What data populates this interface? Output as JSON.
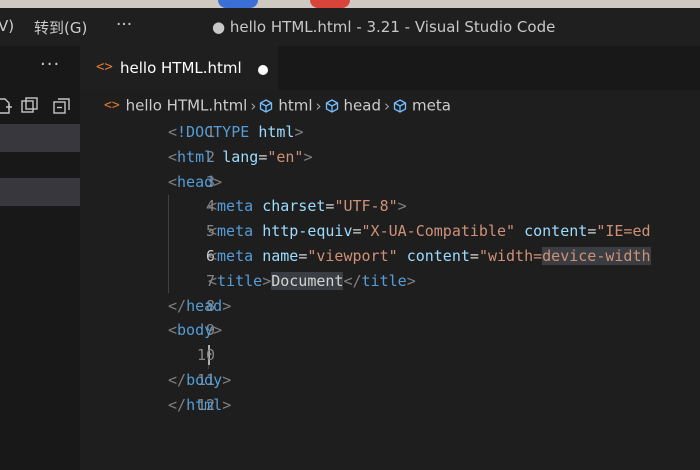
{
  "window": {
    "menu_partial": "V)",
    "menu_goto": "转到(G)",
    "menu_more": "···",
    "title": "● hello HTML.html - 3.21 - Visual Studio Code"
  },
  "sidebar": {
    "more": "···",
    "icons": [
      "new-file-icon",
      "new-folder-icon",
      "refresh-icon",
      "collapse-all-icon"
    ]
  },
  "tab": {
    "icon": "<>",
    "label": "hello HTML.html",
    "dirty": true
  },
  "breadcrumb": {
    "file": "hello HTML.html",
    "items": [
      "html",
      "head",
      "meta"
    ]
  },
  "editor": {
    "active_line": 6,
    "cursor_line": 10,
    "lines": [
      {
        "n": "1"
      },
      {
        "n": "2"
      },
      {
        "n": "3"
      },
      {
        "n": "4"
      },
      {
        "n": "5"
      },
      {
        "n": "6"
      },
      {
        "n": "7"
      },
      {
        "n": "8"
      },
      {
        "n": "9"
      },
      {
        "n": "10"
      },
      {
        "n": "11"
      },
      {
        "n": "12"
      }
    ],
    "tokens": {
      "doctype": "!DOCTYPE",
      "html": "html",
      "head": "head",
      "meta": "meta",
      "title": "title",
      "body": "body",
      "lang": "lang",
      "en": "\"en\"",
      "charset": "charset",
      "utf8": "\"UTF-8\"",
      "http_equiv": "http-equiv",
      "xua": "\"X-UA-Compatible\"",
      "content": "content",
      "ie_partial": "\"IE=ed",
      "name": "name",
      "viewport": "\"viewport\"",
      "width_eq": "\"width=",
      "device_width": "device-width",
      "document": "Document"
    }
  },
  "colors": {
    "background": "#1e1e1e",
    "tag": "#569cd6",
    "attr": "#9cdcfe",
    "string": "#ce9178",
    "html_icon": "#e37933"
  }
}
